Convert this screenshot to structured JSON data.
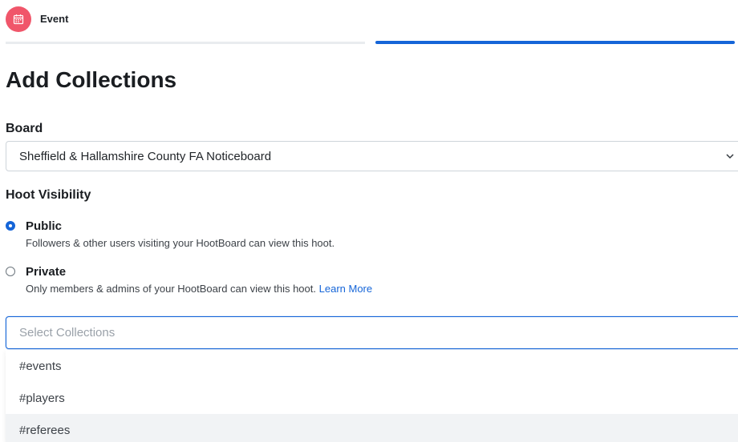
{
  "step": {
    "icon": "calendar-icon",
    "label": "Event",
    "icon_color": "#f0566a",
    "active_color": "#1565d8"
  },
  "page_title": "Add Collections",
  "board": {
    "label": "Board",
    "selected": "Sheffield & Hallamshire County FA Noticeboard"
  },
  "visibility": {
    "label": "Hoot Visibility",
    "options": [
      {
        "title": "Public",
        "description": "Followers & other users visiting your HootBoard can view this hoot.",
        "checked": true
      },
      {
        "title": "Private",
        "description": "Only members & admins of your HootBoard can view this hoot.",
        "link": "Learn More",
        "checked": false
      }
    ]
  },
  "collections": {
    "placeholder": "Select Collections",
    "options": [
      "#events",
      "#players",
      "#referees"
    ],
    "highlighted": "#referees"
  }
}
